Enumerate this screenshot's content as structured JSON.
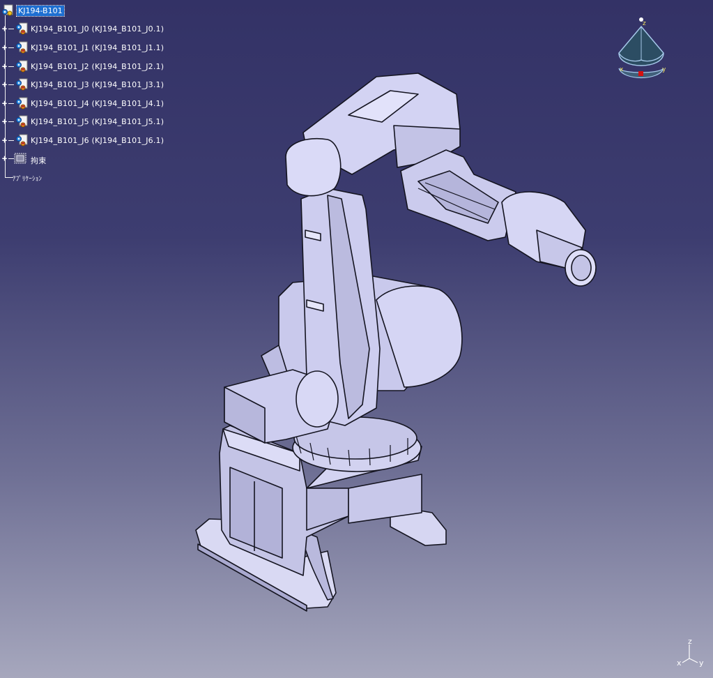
{
  "tree": {
    "root": {
      "label": "KJ194-B101",
      "icon": "product-icon"
    },
    "items": [
      {
        "label": "KJ194_B101_J0 (KJ194_B101_J0.1)",
        "icon": "part-icon"
      },
      {
        "label": "KJ194_B101_J1 (KJ194_B101_J1.1)",
        "icon": "part-icon"
      },
      {
        "label": "KJ194_B101_J2 (KJ194_B101_J2.1)",
        "icon": "part-icon"
      },
      {
        "label": "KJ194_B101_J3 (KJ194_B101_J3.1)",
        "icon": "part-icon"
      },
      {
        "label": "KJ194_B101_J4 (KJ194_B101_J4.1)",
        "icon": "part-icon"
      },
      {
        "label": "KJ194_B101_J5 (KJ194_B101_J5.1)",
        "icon": "part-icon"
      },
      {
        "label": "KJ194_B101_J6 (KJ194_B101_J6.1)",
        "icon": "part-icon"
      }
    ],
    "constraints": {
      "label": "拘束",
      "icon": "constraints-icon"
    },
    "applications": {
      "label": "ｱﾌﾟﾘｹｰｼｮﾝ"
    }
  },
  "compass": {
    "labels": {
      "z": "z",
      "x": "x",
      "y": "y"
    }
  },
  "triad": {
    "labels": {
      "z": "z",
      "x": "x",
      "y": "y"
    }
  },
  "model": {
    "name": "6-axis industrial robot"
  },
  "colors": {
    "background_top": "#333266",
    "background_bottom": "#a6a7bd",
    "model_fill": "#cfcff0",
    "model_edge": "#141420",
    "selection": "#1e6fd1",
    "compass_fill": "#2c4d63"
  }
}
